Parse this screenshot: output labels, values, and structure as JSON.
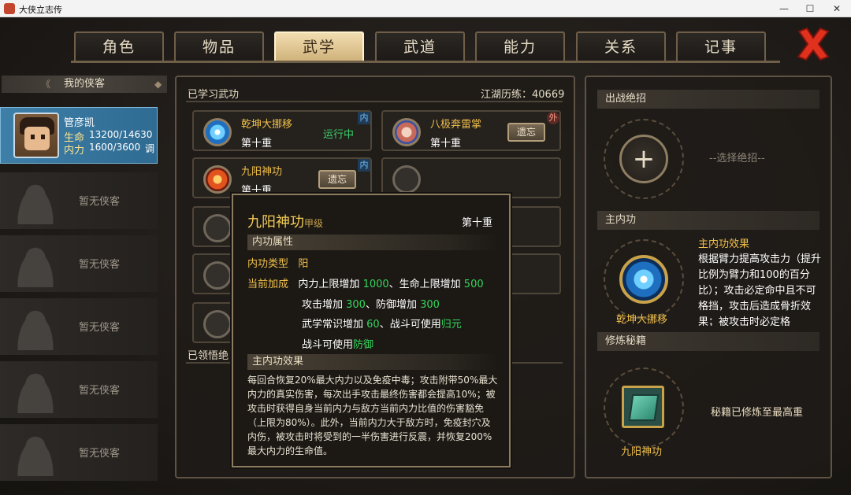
{
  "window": {
    "title": "大侠立志传",
    "min": "—",
    "max": "☐",
    "close": "✕"
  },
  "tabs": [
    {
      "label": "角色",
      "active": false
    },
    {
      "label": "物品",
      "active": false
    },
    {
      "label": "武学",
      "active": true
    },
    {
      "label": "武道",
      "active": false
    },
    {
      "label": "能力",
      "active": false
    },
    {
      "label": "关系",
      "active": false
    },
    {
      "label": "记事",
      "active": false
    }
  ],
  "left": {
    "header": "我的侠客",
    "selected": {
      "name": "管彦凯",
      "hp_label": "生命",
      "hp": "13200/14630",
      "mp_label": "内力",
      "mp": "1600/3600",
      "mp_suffix": "调"
    },
    "empty_label": "暂无侠客"
  },
  "center": {
    "learned_title": "已学习武功",
    "reputation": "江湖历练：40669",
    "skills": [
      {
        "name": "乾坤大挪移",
        "level": "第十重",
        "status": "运行中",
        "tag": "内",
        "icon": "swirl-blue-icon"
      },
      {
        "name": "八极奔雷掌",
        "level": "第十重",
        "action": "遗忘",
        "tag": "外",
        "icon": "fist-icon"
      },
      {
        "name": "九阳神功",
        "level": "第十重",
        "action": "遗忘",
        "tag": "内",
        "icon": "flame-figure-icon"
      }
    ],
    "comprehended_title": "已领悟绝"
  },
  "tooltip": {
    "name": "九阳神功",
    "grade": "甲级",
    "level": "第十重",
    "section_attr": "内功属性",
    "type_key": "内功类型",
    "type_val": "阳",
    "bonus_key": "当前加成",
    "bonus_lines": [
      {
        "a": "内力上限增加 ",
        "b": "1000",
        "c": "、生命上限增加 ",
        "d": "500"
      },
      {
        "a": "攻击增加 ",
        "b": "300",
        "c": "、防御增加 ",
        "d": "300"
      },
      {
        "a": "武学常识增加 ",
        "b": "60",
        "c": "、战斗可使用",
        "d": "归元"
      },
      {
        "a": "战斗可使用",
        "b": "防御",
        "c": "",
        "d": ""
      }
    ],
    "section_effect": "主内功效果",
    "effect": "每回合恢复20%最大内力以及免疫中毒；攻击附带50%最大内力的真实伤害，每次出手攻击最终伤害都会提高10%；被攻击时获得自身当前内力与敌方当前内力比值的伤害豁免（上限为80%）。此外，当前内力大于敌方时，免疫封穴及内伤，被攻击时将受到的一半伤害进行反震，并恢复200%最大内力的生命值。"
  },
  "right": {
    "ultimate_title": "出战绝招",
    "choose_ultimate": "--选择绝招--",
    "main_inner_title": "主内功",
    "main_inner_name": "乾坤大挪移",
    "main_effect_title": "主内功效果",
    "main_effect_text": "根据臂力提高攻击力（提升比例为臂力和100的百分比）；攻击必定命中且不可格挡，攻击后造成骨折效果；被攻击时必定格",
    "training_title": "修炼秘籍",
    "book_name": "九阳神功",
    "book_status": "秘籍已修炼至最高重"
  }
}
